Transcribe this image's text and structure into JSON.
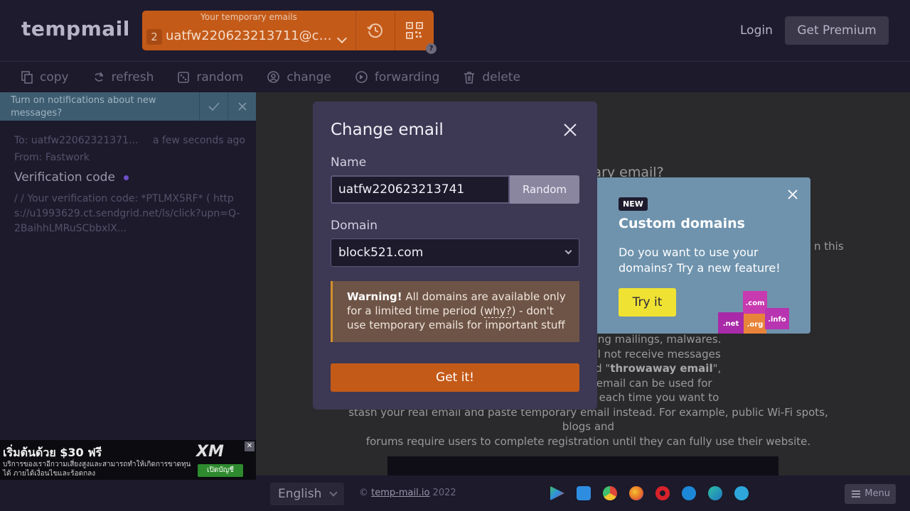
{
  "header": {
    "logo": "tempmail",
    "email_caption": "Your temporary emails",
    "email_count": "2",
    "email_value": "uatfw220623213711@coo...",
    "help": "?",
    "login": "Login",
    "premium": "Get Premium"
  },
  "toolbar": {
    "copy": "copy",
    "refresh": "refresh",
    "random": "random",
    "change": "change",
    "forwarding": "forwarding",
    "delete": "delete"
  },
  "notification": {
    "text": "Turn on notifications about new messages?"
  },
  "mail": {
    "to": "To: uatfw22062321371...",
    "time": "a few seconds ago",
    "from": "From: Fastwork",
    "subject": "Verification code",
    "preview": "/ / Your verification code: *PTLMX5RF* ( https://u1993629.ct.sendgrid.net/ls/click?upn=Q-2BaihhLMRuSCbbxlX..."
  },
  "ad": {
    "title": "เริ่มต้นด้วย $30 ฟรี",
    "subtitle": "บริการของเราอีกวามเสี่ยงสูงและสามารถทำให้เกิดการขาดทุนได้ ภายได้เงื่อนไขและร้อตกลง",
    "logo": "XM",
    "cta": "เปิดบัญชี",
    "close": "✕"
  },
  "main": {
    "heading": "orary email?",
    "fragment": "n this",
    "body_lines": [
      "dress from spam, advertising mailings, malwares.",
      "me period: if this email will not receive messages",
      "posable email is also called \"throwaway email\",",
      "\"fake mail\". Temporary email can be used for",
      "s from file hostings, use it each time you want to",
      "stash your real email and paste temporary email instead. For example, public Wi-Fi spots, blogs and",
      "forums require users to complete registration until they can fully use their website."
    ]
  },
  "footer": {
    "language": "English",
    "copyright_prefix": "©",
    "copyright_link": "temp-mail.io",
    "copyright_year": "2022",
    "menu": "Menu"
  },
  "modal": {
    "title": "Change email",
    "name_label": "Name",
    "name_value": "uatfw220623213741",
    "random_label": "Random",
    "domain_label": "Domain",
    "domain_value": "block521.com",
    "warning_strong": "Warning!",
    "warning_text_1": " All domains are available only for a limited time period (",
    "warning_why": "why?",
    "warning_text_2": ") - don't use temporary emails for important stuff",
    "submit": "Get it!"
  },
  "promo": {
    "badge": "NEW",
    "title": "Custom domains",
    "text": "Do you want to use your domains? Try a new feature!",
    "cta": "Try it",
    "tlds": [
      ".com",
      ".net",
      ".org",
      ".info"
    ]
  },
  "colors": {
    "accent": "#c45a18",
    "modal_bg": "#3d3853",
    "promo_bg": "#6f93ad",
    "try_button": "#f0e233",
    "unread_dot": "#6e4fc8"
  }
}
